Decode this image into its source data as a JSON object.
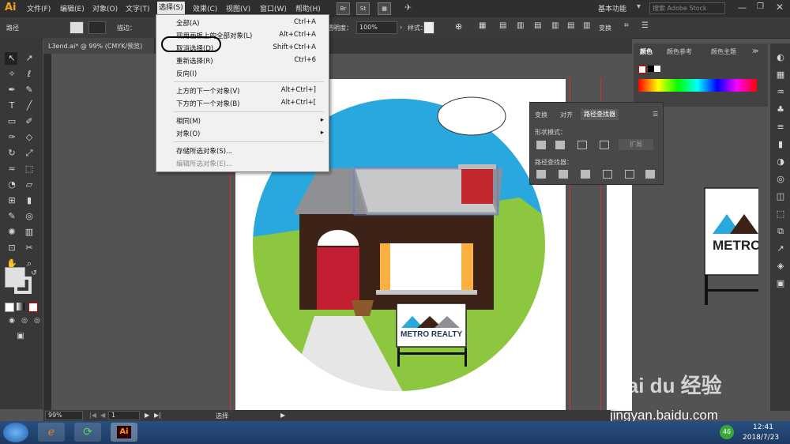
{
  "app": {
    "logo": "Ai"
  },
  "menubar": {
    "items": [
      "文件(F)",
      "编辑(E)",
      "对象(O)",
      "文字(T)",
      "选择(S)",
      "效果(C)",
      "视图(V)",
      "窗口(W)",
      "帮助(H)"
    ],
    "chips": [
      "Br",
      "St"
    ],
    "workspace": "基本功能",
    "search_placeholder": "搜索 Adobe Stock"
  },
  "control": {
    "selection_label": "路径",
    "stroke_label": "描边：",
    "opacity_label": "透明度：",
    "opacity_value": "100%",
    "style_label": "样式：",
    "transform_label": "变换"
  },
  "document": {
    "tab_title": "L3end.ai* @ 99% (CMYK/预览)"
  },
  "status": {
    "zoom": "99%",
    "artboard": "1",
    "mode": "选择"
  },
  "select_menu": {
    "items": [
      {
        "label": "全部(A)",
        "shortcut": "Ctrl+A",
        "enabled": true
      },
      {
        "label": "现用画板上的全部对象(L)",
        "shortcut": "Alt+Ctrl+A",
        "enabled": true
      },
      {
        "label": "取消选择(D)",
        "shortcut": "Shift+Ctrl+A",
        "enabled": true,
        "circled": true
      },
      {
        "label": "重新选择(R)",
        "shortcut": "Ctrl+6",
        "enabled": true
      },
      {
        "label": "反向(I)",
        "shortcut": "",
        "enabled": true
      },
      {
        "label": "上方的下一个对象(V)",
        "shortcut": "Alt+Ctrl+]",
        "enabled": true
      },
      {
        "label": "下方的下一个对象(B)",
        "shortcut": "Alt+Ctrl+[",
        "enabled": true
      },
      {
        "label": "相同(M)",
        "shortcut": "▸",
        "enabled": true
      },
      {
        "label": "对象(O)",
        "shortcut": "▸",
        "enabled": true
      },
      {
        "label": "存储所选对象(S)...",
        "shortcut": "",
        "enabled": true
      },
      {
        "label": "编辑所选对象(E)...",
        "shortcut": "",
        "enabled": false
      }
    ]
  },
  "color_panel": {
    "tabs": [
      "颜色",
      "颜色参考",
      "颜色主题"
    ]
  },
  "pathfinder": {
    "tabs": [
      "变换",
      "对齐",
      "路径查找器"
    ],
    "shape_modes_label": "形状模式：",
    "expand_label": "扩展",
    "pathfinders_label": "路径查找器："
  },
  "artwork": {
    "sign_text": "METRO REALTY",
    "sign_text_partial": "METRO",
    "colors": {
      "sky": "#29a8e0",
      "grass": "#8dc63f",
      "house": "#3d2317",
      "roof": "#8f9094",
      "door": "#c21f32",
      "curtain": "#fbb040",
      "chimney": "#c1272d"
    }
  },
  "watermark": {
    "brand": "Bai du 经验",
    "url": "jingyan.baidu.com"
  },
  "taskbar": {
    "time": "12:41",
    "date": "2018/7/23",
    "badge": "46"
  }
}
